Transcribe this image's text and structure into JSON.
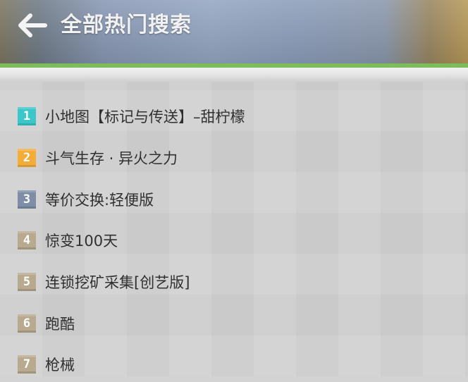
{
  "header": {
    "title": "全部热门搜索",
    "back_icon": "arrow-left-icon"
  },
  "colors": {
    "accent_green": "#7cbc5a",
    "rank_1": "#3bc6c9",
    "rank_2": "#f5ad3a",
    "rank_3": "#7d8ea6",
    "rank_other": "#b8a98f"
  },
  "items": [
    {
      "rank": "1",
      "label": "小地图【标记与传送】–甜柠檬"
    },
    {
      "rank": "2",
      "label": "斗气生存 · 异火之力"
    },
    {
      "rank": "3",
      "label": "等价交换:轻便版"
    },
    {
      "rank": "4",
      "label": "惊变100天"
    },
    {
      "rank": "5",
      "label": "连锁挖矿采集[创艺版]"
    },
    {
      "rank": "6",
      "label": "跑酷"
    },
    {
      "rank": "7",
      "label": "枪械"
    }
  ]
}
